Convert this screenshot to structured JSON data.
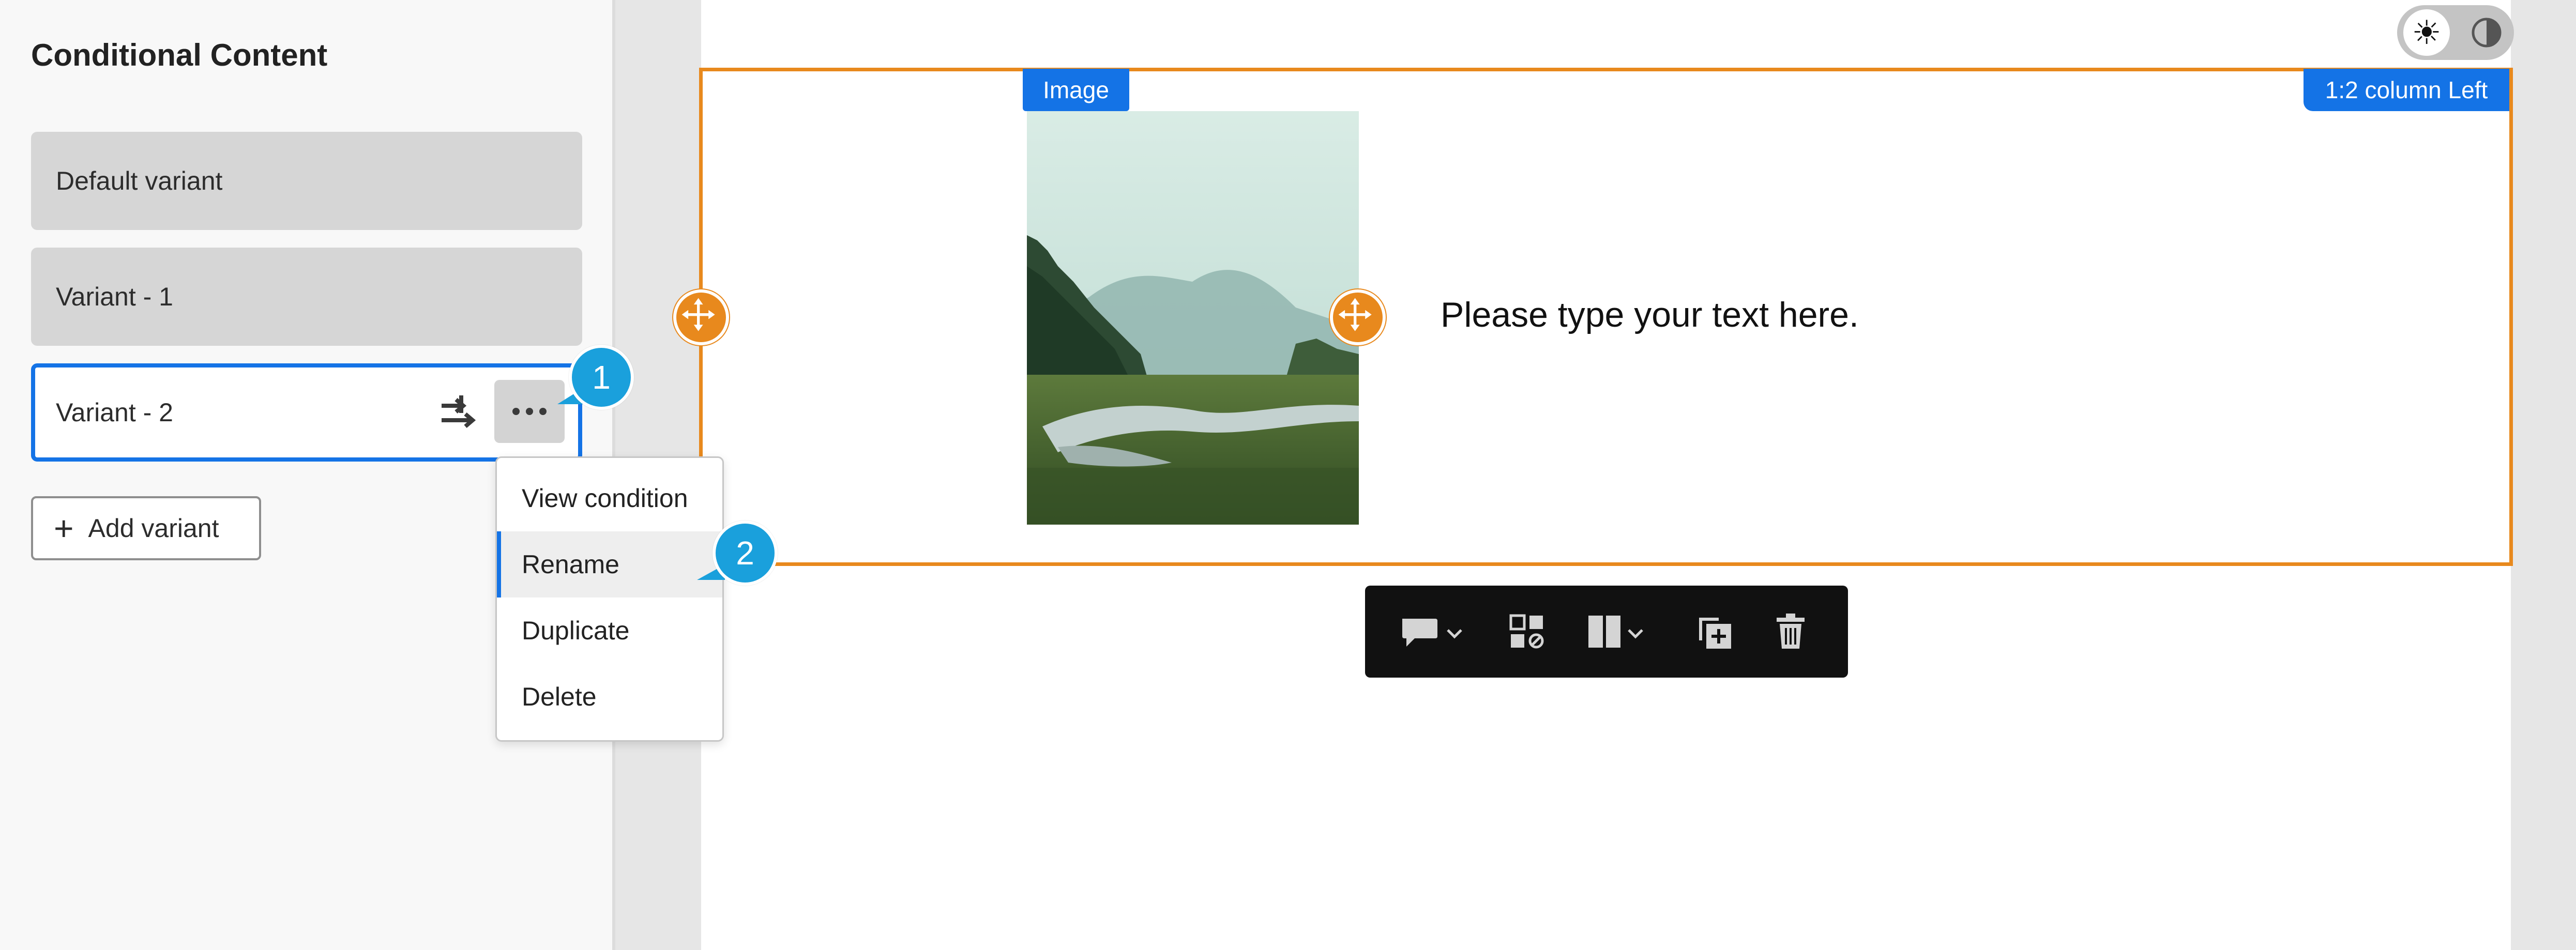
{
  "panel": {
    "title": "Conditional Content",
    "variants": [
      {
        "label": "Default variant",
        "selected": false
      },
      {
        "label": "Variant - 1",
        "selected": false
      },
      {
        "label": "Variant - 2",
        "selected": true
      }
    ],
    "add_variant_label": "Add variant"
  },
  "context_menu": {
    "items": [
      {
        "label": "View condition",
        "active": false
      },
      {
        "label": "Rename",
        "active": true
      },
      {
        "label": "Duplicate",
        "active": false
      },
      {
        "label": "Delete",
        "active": false
      }
    ]
  },
  "callouts": [
    "1",
    "2"
  ],
  "canvas": {
    "image_tag": "Image",
    "column_tag": "1:2 column Left",
    "body_text": "Please type your text here."
  },
  "theme_toggle": {
    "mode": "light"
  },
  "toolbar": {
    "icons": [
      "comment-icon",
      "dropdown-chevron-icon",
      "conditional-content-icon",
      "columns-icon",
      "dropdown-chevron-icon",
      "duplicate-icon",
      "trash-icon"
    ]
  },
  "colors": {
    "accent": "#1473e6",
    "selection_frame": "#e8891d",
    "callout": "#1aa0dc",
    "toolbar_bg": "#111111"
  }
}
